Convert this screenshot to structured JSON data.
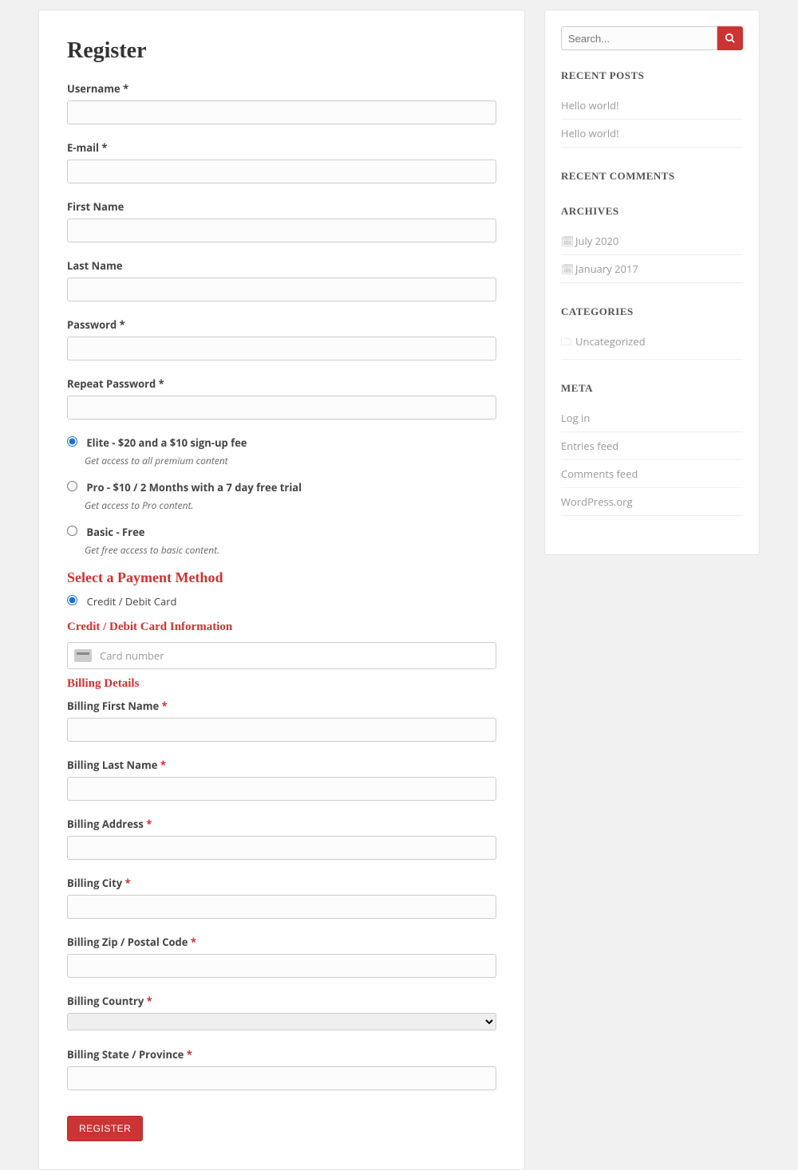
{
  "page": {
    "title": "Register"
  },
  "form": {
    "username_label": "Username *",
    "email_label": "E-mail *",
    "firstname_label": "First Name",
    "lastname_label": "Last Name",
    "password_label": "Password *",
    "repeat_password_label": "Repeat Password *",
    "plans": [
      {
        "label": "Elite - $20 and a $10 sign-up fee",
        "desc": "Get access to all premium content",
        "checked": true
      },
      {
        "label": "Pro - $10 / 2 Months with a 7 day free trial",
        "desc": "Get access to Pro content.",
        "checked": false
      },
      {
        "label": "Basic - Free",
        "desc": "Get free access to basic content.",
        "checked": false
      }
    ],
    "payment_head": "Select a Payment Method",
    "payment_method_label": "Credit / Debit Card",
    "card_head": "Credit / Debit Card Information",
    "card_placeholder": "Card number",
    "billing_head": "Billing Details",
    "billing": {
      "first": "Billing First Name",
      "last": "Billing Last Name",
      "address": "Billing Address",
      "city": "Billing City",
      "zip": "Billing Zip / Postal Code",
      "country": "Billing Country",
      "state": "Billing State / Province"
    },
    "register_btn": "REGISTER"
  },
  "sidebar": {
    "search_placeholder": "Search...",
    "recent_posts_title": "RECENT POSTS",
    "recent_posts": [
      "Hello world!",
      "Hello world!"
    ],
    "recent_comments_title": "RECENT COMMENTS",
    "archives_title": "ARCHIVES",
    "archives": [
      "July 2020",
      "January 2017"
    ],
    "categories_title": "CATEGORIES",
    "categories": [
      "Uncategorized"
    ],
    "meta_title": "META",
    "meta": [
      "Log in",
      "Entries feed",
      "Comments feed",
      "WordPress.org"
    ]
  },
  "asterisk": "*"
}
